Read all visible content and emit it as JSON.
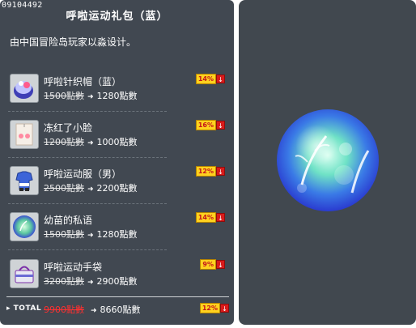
{
  "item_id": "09104492",
  "title": "呼啦运动礼包（蓝）",
  "description": "由中国冒险岛玩家以淼设计。",
  "items": [
    {
      "name": "呼啦针织帽（蓝）",
      "old_price": "1500點數",
      "new_price": "1280點數",
      "discount": "14%",
      "icon": "knit-hat-icon"
    },
    {
      "name": "冻红了小脸",
      "old_price": "1200點數",
      "new_price": "1000點數",
      "discount": "16%",
      "icon": "red-cheek-face-icon"
    },
    {
      "name": "呼啦运动服（男）",
      "old_price": "2500點數",
      "new_price": "2200點數",
      "discount": "12%",
      "icon": "sportswear-icon"
    },
    {
      "name": "幼苗的私语",
      "old_price": "1500點數",
      "new_price": "1280點數",
      "discount": "14%",
      "icon": "sprout-whisper-icon"
    },
    {
      "name": "呼啦运动手袋",
      "old_price": "3200點數",
      "new_price": "2900點數",
      "discount": "9%",
      "icon": "handbag-icon"
    }
  ],
  "total": {
    "label": "TOTAL",
    "old_price": "9900點數",
    "new_price": "8660點數",
    "discount": "12%"
  },
  "colors": {
    "panel_bg": "#414851",
    "badge_yellow": "#ffd21f",
    "badge_red": "#d81b1b",
    "total_old_red": "#ff3030"
  }
}
